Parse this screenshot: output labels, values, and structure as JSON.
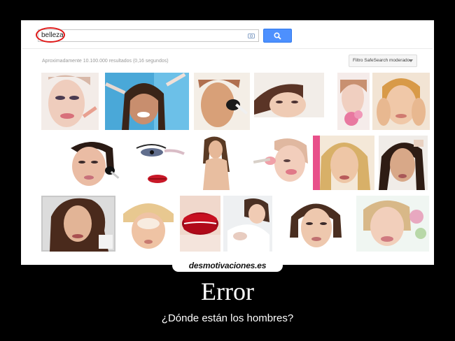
{
  "search": {
    "query": "belleza",
    "results_count": "Aproximadamente 10.100.000 resultados (0,16 segundos)",
    "safe_search_label": "Filtro SafeSearch moderado"
  },
  "icons": {
    "camera": "camera-icon",
    "search": "search-icon",
    "dropdown": "chevron-down-icon"
  },
  "colors": {
    "search_button": "#4d90fe",
    "highlight_circle": "#e01818"
  },
  "thumbnails": [
    {
      "name": "makeup-face-1"
    },
    {
      "name": "makeup-brushes-face"
    },
    {
      "name": "makeup-blush-brush"
    },
    {
      "name": "lying-woman"
    },
    {
      "name": "woman-with-flower"
    },
    {
      "name": "facial-massage"
    },
    {
      "name": "makeup-brush-cheek"
    },
    {
      "name": "eyes-and-lips"
    },
    {
      "name": "woman-back"
    },
    {
      "name": "woman-brush-pink"
    },
    {
      "name": "blonde-woman"
    },
    {
      "name": "dark-hair-woman"
    },
    {
      "name": "curly-hair-portrait"
    },
    {
      "name": "towel-face-mask"
    },
    {
      "name": "red-lips"
    },
    {
      "name": "spa-woman"
    },
    {
      "name": "short-hair-woman"
    },
    {
      "name": "smiling-woman-flowers"
    }
  ],
  "poster": {
    "site": "desmotivaciones.es",
    "title": "Error",
    "caption": "¿Dónde están los hombres?"
  }
}
